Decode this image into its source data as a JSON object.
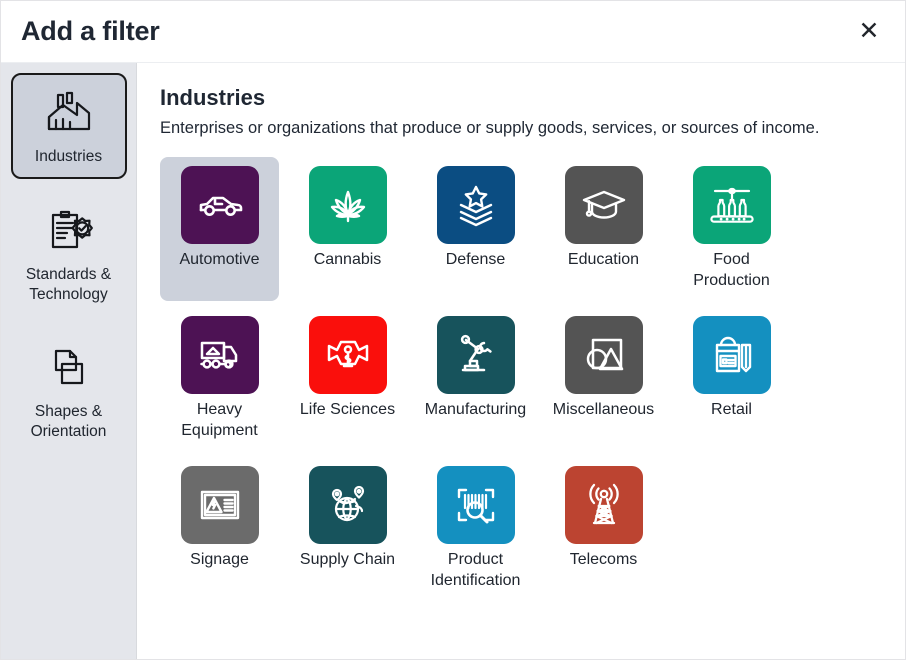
{
  "dialog": {
    "title": "Add a filter",
    "close_label": "✕",
    "close_icon": "close-icon"
  },
  "sidebar": {
    "items": [
      {
        "id": "industries",
        "label": "Industries",
        "icon": "factory-icon",
        "selected": true
      },
      {
        "id": "standards-technology",
        "label": "Standards & Technology",
        "icon": "clipboard-check-icon",
        "selected": false
      },
      {
        "id": "shapes-orientation",
        "label": "Shapes & Orientation",
        "icon": "shapes-folder-icon",
        "selected": false
      }
    ]
  },
  "content": {
    "title": "Industries",
    "description": "Enterprises or organizations that produce or supply goods, services, or sources of income.",
    "tiles": [
      {
        "id": "automotive",
        "label": "Automotive",
        "icon": "car-icon",
        "color": "#4d1254",
        "selected": true
      },
      {
        "id": "cannabis",
        "label": "Cannabis",
        "icon": "cannabis-leaf-icon",
        "color": "#0ba578",
        "selected": false
      },
      {
        "id": "defense",
        "label": "Defense",
        "icon": "military-rank-icon",
        "color": "#0b4d82",
        "selected": false
      },
      {
        "id": "education",
        "label": "Education",
        "icon": "graduation-cap-icon",
        "color": "#545454",
        "selected": false
      },
      {
        "id": "food-production",
        "label": "Food Production",
        "icon": "bottling-line-icon",
        "color": "#0ba578",
        "selected": false
      },
      {
        "id": "heavy-equipment",
        "label": "Heavy Equipment",
        "icon": "dump-truck-icon",
        "color": "#4d1254",
        "selected": false
      },
      {
        "id": "life-sciences",
        "label": "Life Sciences",
        "icon": "medical-star-icon",
        "color": "#fa0f0c",
        "selected": false
      },
      {
        "id": "manufacturing",
        "label": "Manufacturing",
        "icon": "robot-arm-icon",
        "color": "#17535c",
        "selected": false
      },
      {
        "id": "miscellaneous",
        "label": "Miscellaneous",
        "icon": "shapes-icon",
        "color": "#545454",
        "selected": false
      },
      {
        "id": "retail",
        "label": "Retail",
        "icon": "shopping-bag-icon",
        "color": "#1490c0",
        "selected": false
      },
      {
        "id": "signage",
        "label": "Signage",
        "icon": "warning-sign-icon",
        "color": "#6b6b6b",
        "selected": false
      },
      {
        "id": "supply-chain",
        "label": "Supply Chain",
        "icon": "globe-pin-icon",
        "color": "#17535c",
        "selected": false
      },
      {
        "id": "product-identification",
        "label": "Product Identification",
        "icon": "barcode-scan-icon",
        "color": "#1490c0",
        "selected": false
      },
      {
        "id": "telecoms",
        "label": "Telecoms",
        "icon": "cell-tower-icon",
        "color": "#bc4431",
        "selected": false
      }
    ]
  },
  "colors": {
    "sidebar_bg": "#e4e6eb",
    "selected_bg": "#ccd1db",
    "text": "#20262f",
    "title": "#1f2733"
  }
}
